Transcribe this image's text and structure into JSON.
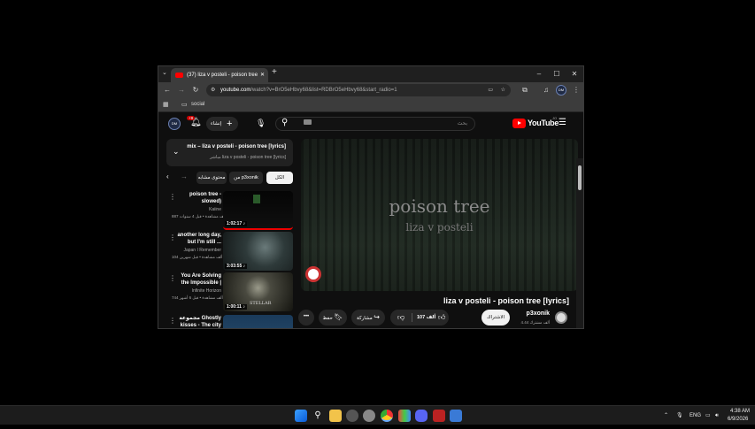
{
  "browser": {
    "tab_title": "(37) liza v posteli - poison tree",
    "new_tab": "+",
    "minimize": "–",
    "maximize": "☐",
    "close": "✕",
    "url_host": "youtube.com",
    "url_path": "/watch?v=BrO5eHbvy68&list=RDBrO5eHbvy68&start_radio=1",
    "bookmark": "social",
    "profile_badge": "DM"
  },
  "youtube": {
    "logo": "YouTube",
    "logo_sup": "JO",
    "search_placeholder": "بحث",
    "create_label": "إنشاء",
    "notif_count": "+9",
    "avatar": "DM",
    "playlist": {
      "title": "mix – liza v posteli - poison tree [lyrics]",
      "subtitle": "مباشر liza v posteli - poison tree [lyrics]"
    },
    "chips": [
      "الكل",
      "من p3xonik",
      "محتوى مشابه"
    ],
    "recs": [
      {
        "title": "poison tree - slowed) grouper...",
        "channel": "Kaiine",
        "stats": "887 ألف مشاهدة • قبل 4 سنوات",
        "duration": "1:02:17 ♪"
      },
      {
        "title": "another long day, but I'm still ...",
        "channel": "Japan I Remember",
        "stats": "104 ألف مشاهدة • قبل شهرين",
        "duration": "3:03:55 ♪"
      },
      {
        "title": "You Are Solving the Impossible | ...",
        "channel": "Infinite Horizon",
        "stats": "744 ألف مشاهدة • قبل 6 أشهر",
        "duration": "1:00:11 ♪"
      },
      {
        "title": "مجموعة Ghostly kisses - The city",
        "channel": "",
        "stats": "",
        "duration": ""
      }
    ],
    "video": {
      "overlay_title": "poison tree",
      "overlay_artist": "liza v posteli",
      "title": "liza v posteli - poison tree [lyrics]",
      "channel": "p3xonik",
      "subs": "4.44 ألف مشترك",
      "subscribe": "الاشتراك",
      "likes": "107 ألف",
      "share": "مشاركة",
      "save": "حفظ",
      "more": "•••"
    }
  },
  "taskbar": {
    "lang": "ENG",
    "time": "4:38 AM",
    "date": "6/9/2026"
  }
}
